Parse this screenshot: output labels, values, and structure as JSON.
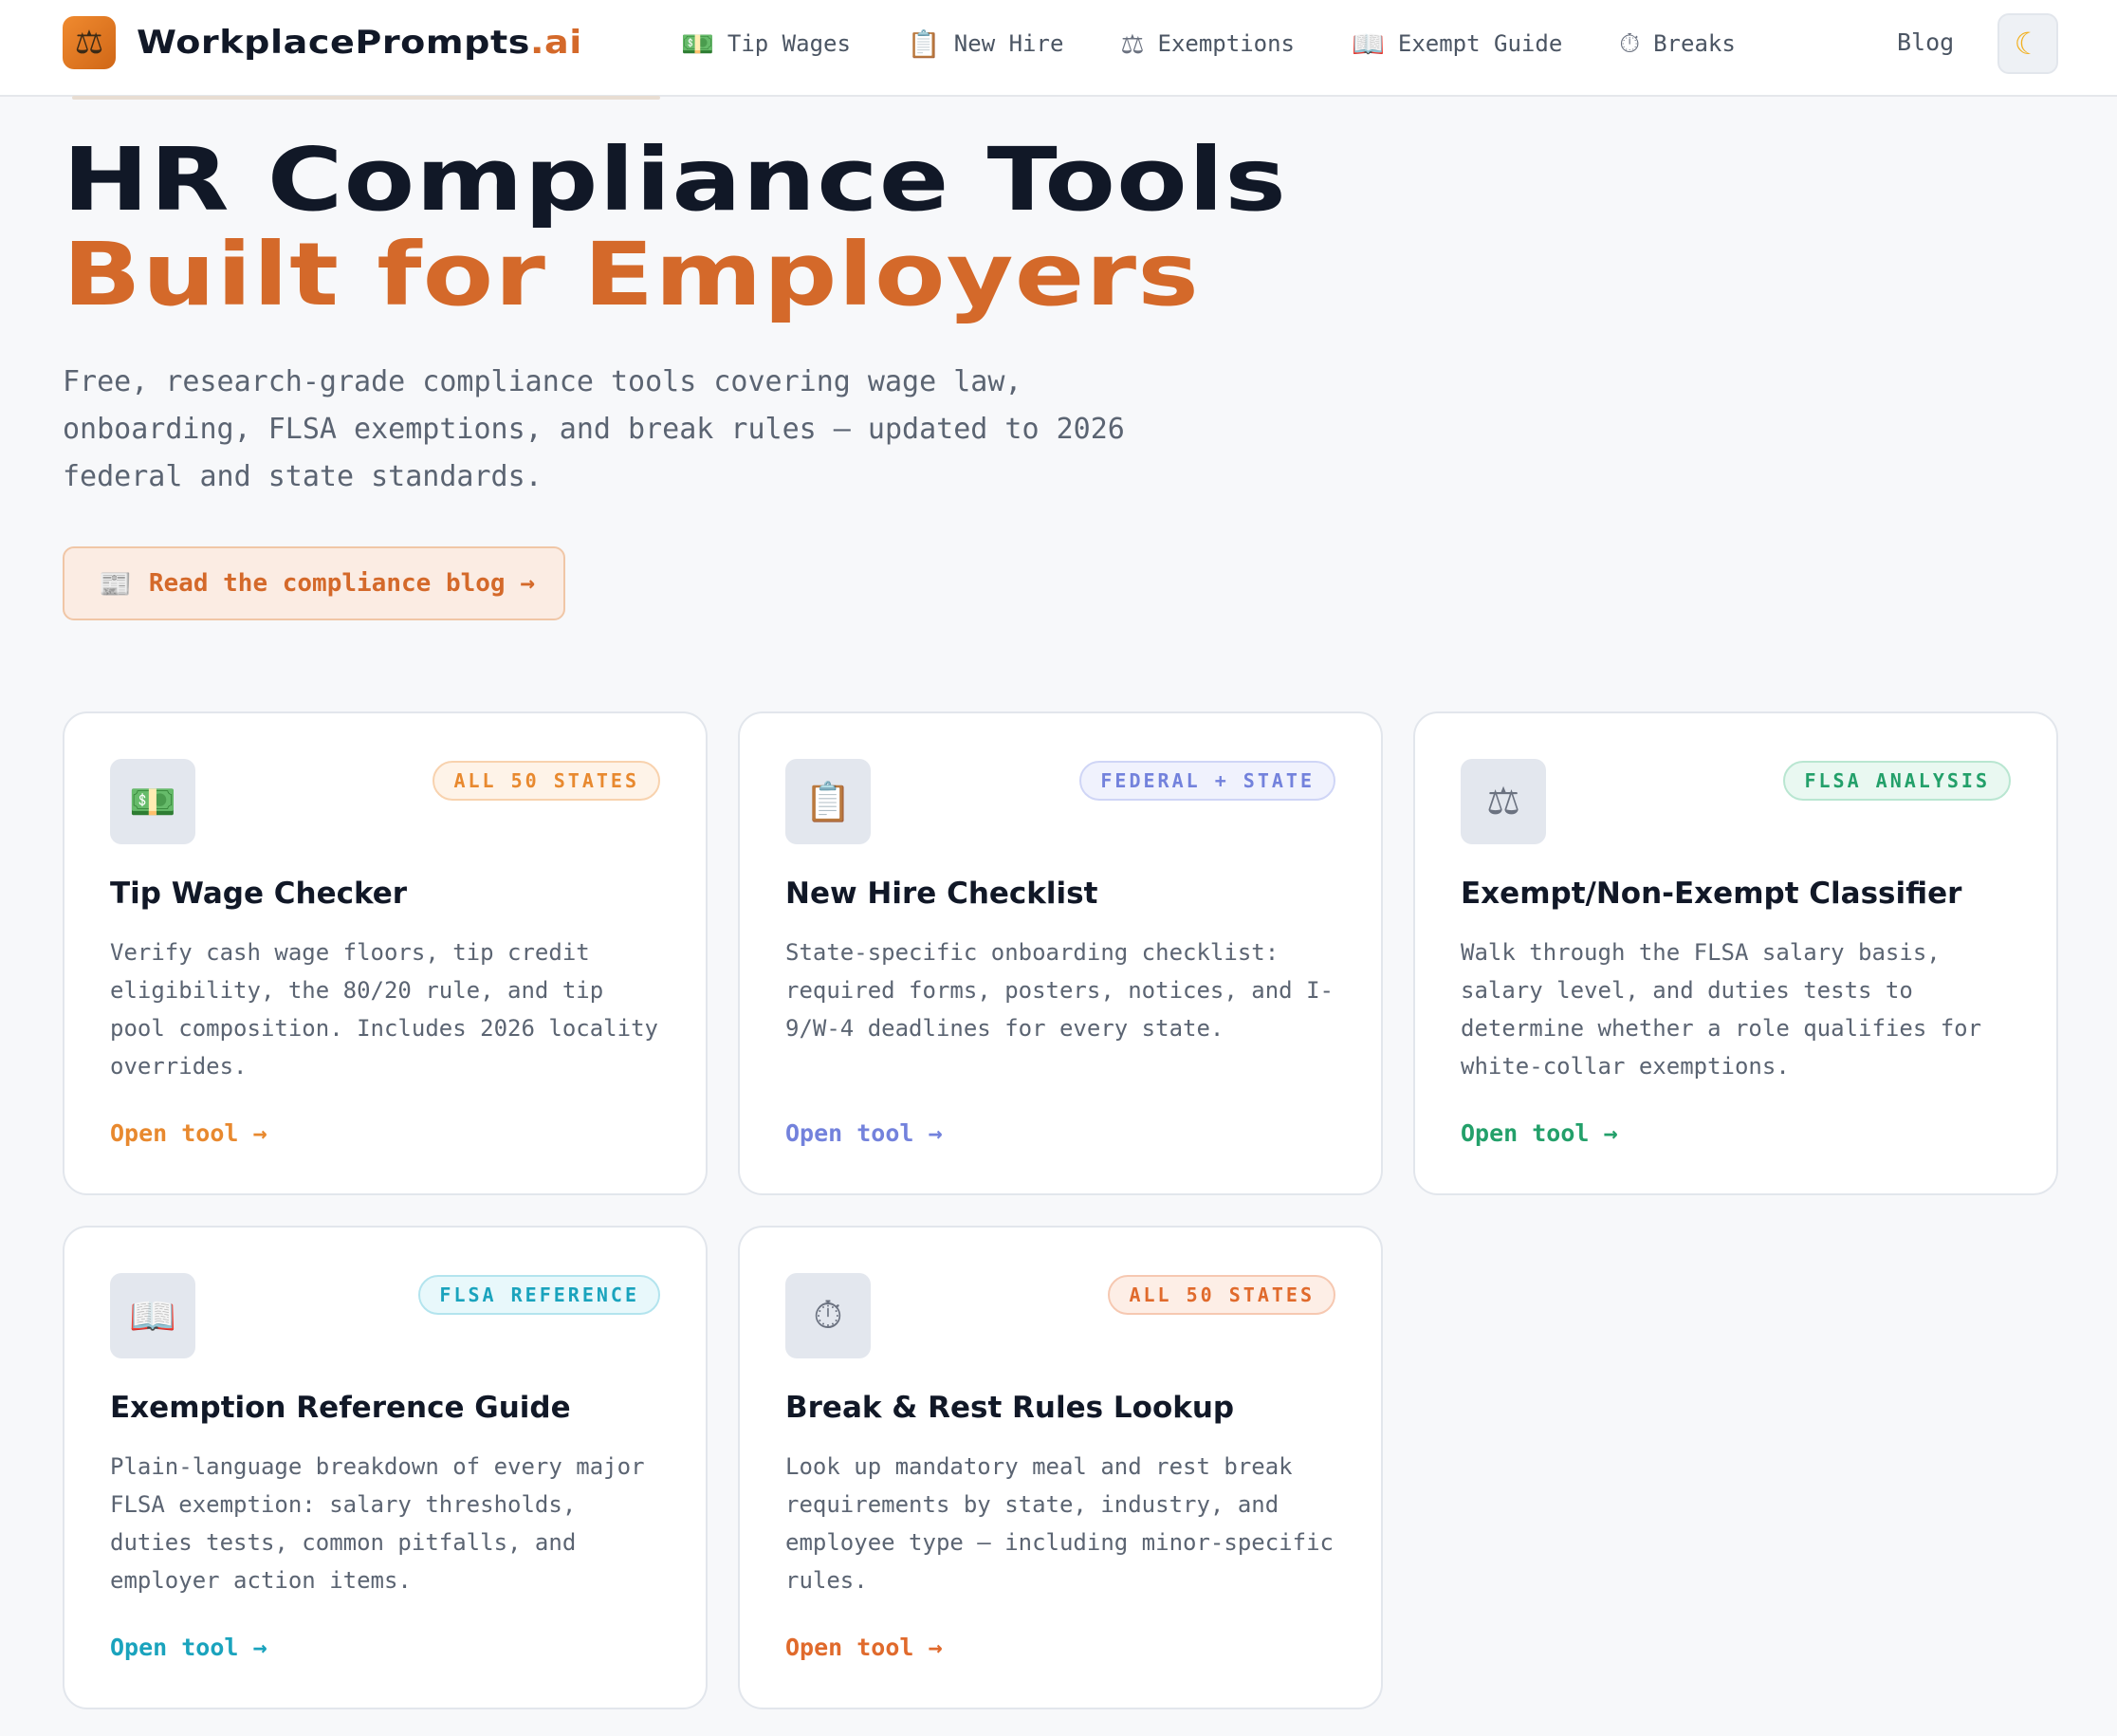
{
  "brand": {
    "logo_icon": "scales-icon",
    "logo_glyph": "⚖",
    "name": "WorkplacePrompts",
    "tld": ".ai"
  },
  "nav": {
    "links": [
      {
        "icon": "money-icon",
        "glyph": "💵",
        "label": "Tip Wages"
      },
      {
        "icon": "clipboard-icon",
        "glyph": "📋",
        "label": "New Hire"
      },
      {
        "icon": "scales-icon",
        "glyph": "⚖",
        "label": "Exemptions"
      },
      {
        "icon": "book-icon",
        "glyph": "📖",
        "label": "Exempt Guide"
      },
      {
        "icon": "stopwatch-icon",
        "glyph": "⏱",
        "label": "Breaks"
      }
    ],
    "blog_label": "Blog",
    "theme_toggle_icon": "moon-icon",
    "theme_toggle_glyph": "☾"
  },
  "hero": {
    "title_line1": "HR Compliance Tools",
    "title_line2": "Built for Employers",
    "description": "Free, research-grade compliance tools covering wage law, onboarding, FLSA exemptions, and break rules — updated to 2026 federal and state standards.",
    "cta_icon": "newspaper-icon",
    "cta_glyph": "📰",
    "cta_label": "Read the compliance blog →"
  },
  "colors": {
    "accent": "#d4692a",
    "orange": "#e8892f",
    "purple": "#7382dc",
    "green": "#23a06a",
    "cyan": "#1aa3bd",
    "red": "#e06a2c"
  },
  "cards": [
    {
      "icon": "money-icon",
      "glyph": "💵",
      "badge": "ALL 50 STATES",
      "title": "Tip Wage Checker",
      "description": "Verify cash wage floors, tip credit eligibility, the 80/20 rule, and tip pool composition. Includes 2026 locality overrides.",
      "link": "Open tool →"
    },
    {
      "icon": "clipboard-icon",
      "glyph": "📋",
      "badge": "FEDERAL + STATE",
      "title": "New Hire Checklist",
      "description": "State-specific onboarding checklist: required forms, posters, notices, and I-9/W-4 deadlines for every state.",
      "link": "Open tool →"
    },
    {
      "icon": "scales-icon",
      "glyph": "⚖",
      "badge": "FLSA ANALYSIS",
      "title": "Exempt/Non-Exempt Classifier",
      "description": "Walk through the FLSA salary basis, salary level, and duties tests to determine whether a role qualifies for white-collar exemptions.",
      "link": "Open tool →"
    },
    {
      "icon": "book-icon",
      "glyph": "📖",
      "badge": "FLSA REFERENCE",
      "title": "Exemption Reference Guide",
      "description": "Plain-language breakdown of every major FLSA exemption: salary thresholds, duties tests, common pitfalls, and employer action items.",
      "link": "Open tool →"
    },
    {
      "icon": "stopwatch-icon",
      "glyph": "⏱",
      "badge": "ALL 50 STATES",
      "title": "Break & Rest Rules Lookup",
      "description": "Look up mandatory meal and rest break requirements by state, industry, and employee type — including minor-specific rules.",
      "link": "Open tool →"
    }
  ]
}
